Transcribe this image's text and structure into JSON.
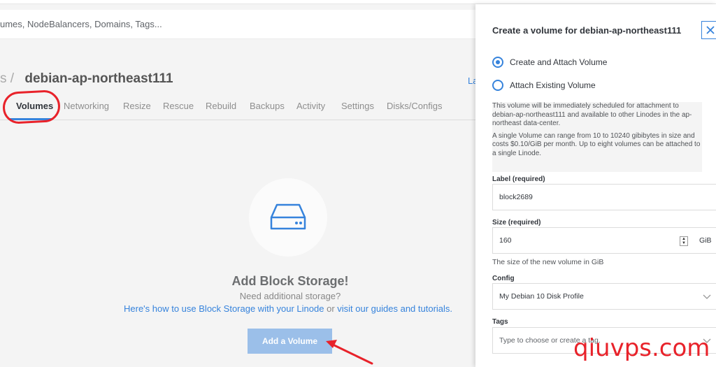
{
  "search": {
    "placeholder_fragment": "umes, NodeBalancers, Domains, Tags..."
  },
  "breadcrumb": {
    "prefix": "s",
    "separator": "/",
    "linode_name": "debian-ap-northeast111"
  },
  "header": {
    "partial_link": "La"
  },
  "tabs": [
    {
      "label": "Volumes",
      "active": true
    },
    {
      "label": "Networking"
    },
    {
      "label": "Resize"
    },
    {
      "label": "Rescue"
    },
    {
      "label": "Rebuild"
    },
    {
      "label": "Backups"
    },
    {
      "label": "Activity"
    },
    {
      "label": "Settings"
    },
    {
      "label": "Disks/Configs"
    }
  ],
  "empty_state": {
    "icon": "block-storage-drive-icon",
    "title": "Add Block Storage!",
    "subtitle": "Need additional storage?",
    "help_link_1": "Here's how to use Block Storage with your Linode",
    "help_or": " or ",
    "help_link_2": "visit our guides and tutorials.",
    "add_button": "Add a Volume"
  },
  "drawer": {
    "title": "Create a volume for debian-ap-northeast111",
    "close_icon": "close-icon",
    "radio_create": "Create and Attach Volume",
    "radio_existing": "Attach Existing Volume",
    "selected_option": "Create and Attach Volume",
    "notice_1": "This volume will be immediately scheduled for attachment to debian-ap-northeast111 and available to other Linodes in the ap-northeast data-center.",
    "notice_2": "A single Volume can range from 10 to 10240 gibibytes in size and costs $0.10/GiB per month. Up to eight volumes can be attached to a single Linode.",
    "label_field": {
      "label": "Label (required)",
      "value": "block2689"
    },
    "size_field": {
      "label": "Size (required)",
      "value": "160",
      "unit": "GiB",
      "helper": "The size of the new volume in GiB"
    },
    "config_field": {
      "label": "Config",
      "value": "My Debian 10 Disk Profile"
    },
    "tags_field": {
      "label": "Tags",
      "placeholder": "Type to choose or create a tag."
    }
  },
  "watermark": "qiuvps.com",
  "colors": {
    "accent": "#3683dc",
    "annotation_red": "#e8222a",
    "button_disabled": "#9bbfe9"
  }
}
